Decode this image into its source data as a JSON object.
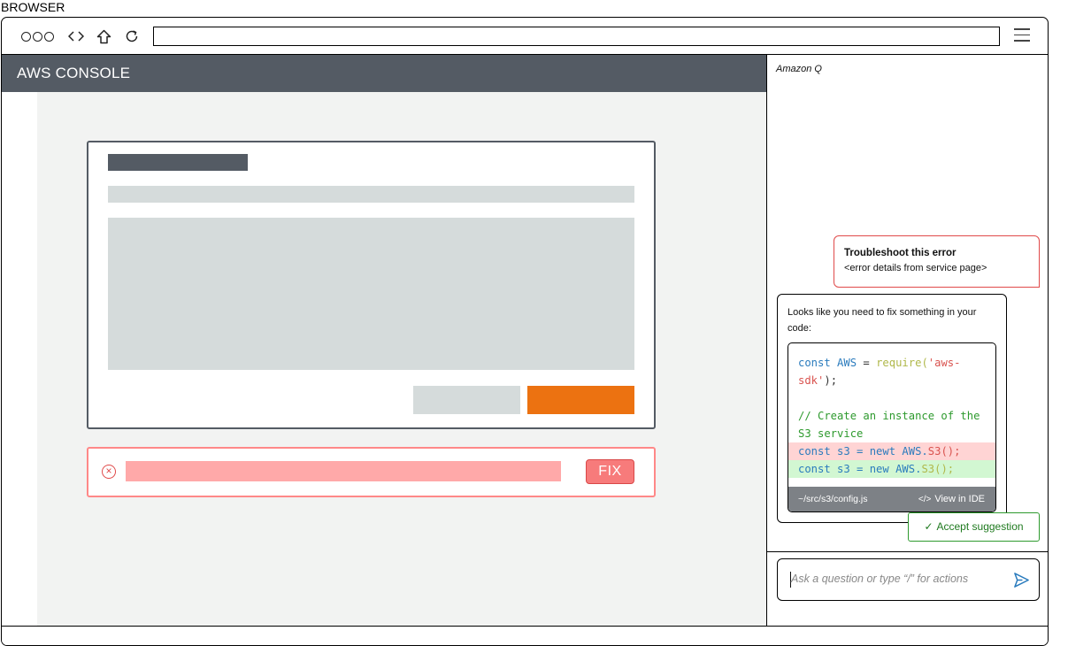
{
  "browser": {
    "label": "BROWSER"
  },
  "toolbar": {
    "icons": [
      "window-controls-icon",
      "code-icon",
      "home-icon",
      "reload-icon",
      "hamburger-menu-icon"
    ],
    "address_value": ""
  },
  "console": {
    "title": "AWS CONSOLE"
  },
  "error": {
    "fix_label": "FIX"
  },
  "q": {
    "title": "Amazon Q",
    "user_msg": {
      "title": "Troubleshoot this error",
      "detail": "<error details from service page>"
    },
    "ai_msg": {
      "intro": "Looks like you need to fix something in your code:",
      "code": {
        "line1a": "const",
        "line1b": "AWS",
        "line1c": "=",
        "line1d": "require(",
        "line1e": "'aws-sdk'",
        "line1f": ");",
        "comment": "// Create an instance of the S3 service",
        "del_a": "const s3 = newt",
        "del_b": "AWS.",
        "del_c": "S3();",
        "add_a": "const s3 = new",
        "add_b": "AWS.",
        "add_c": "S3();"
      },
      "footer_path": "~/src/s3/config.js",
      "footer_ide": "View in IDE"
    },
    "accept_label": "Accept suggestion",
    "input_placeholder": "Ask a question or type “/” for actions"
  },
  "colors": {
    "header_bg": "#545b64",
    "primary_button": "#ec7211",
    "error_border": "#ff8888",
    "accept_green": "#2e9a2e",
    "send_blue": "#2a7bbd"
  }
}
